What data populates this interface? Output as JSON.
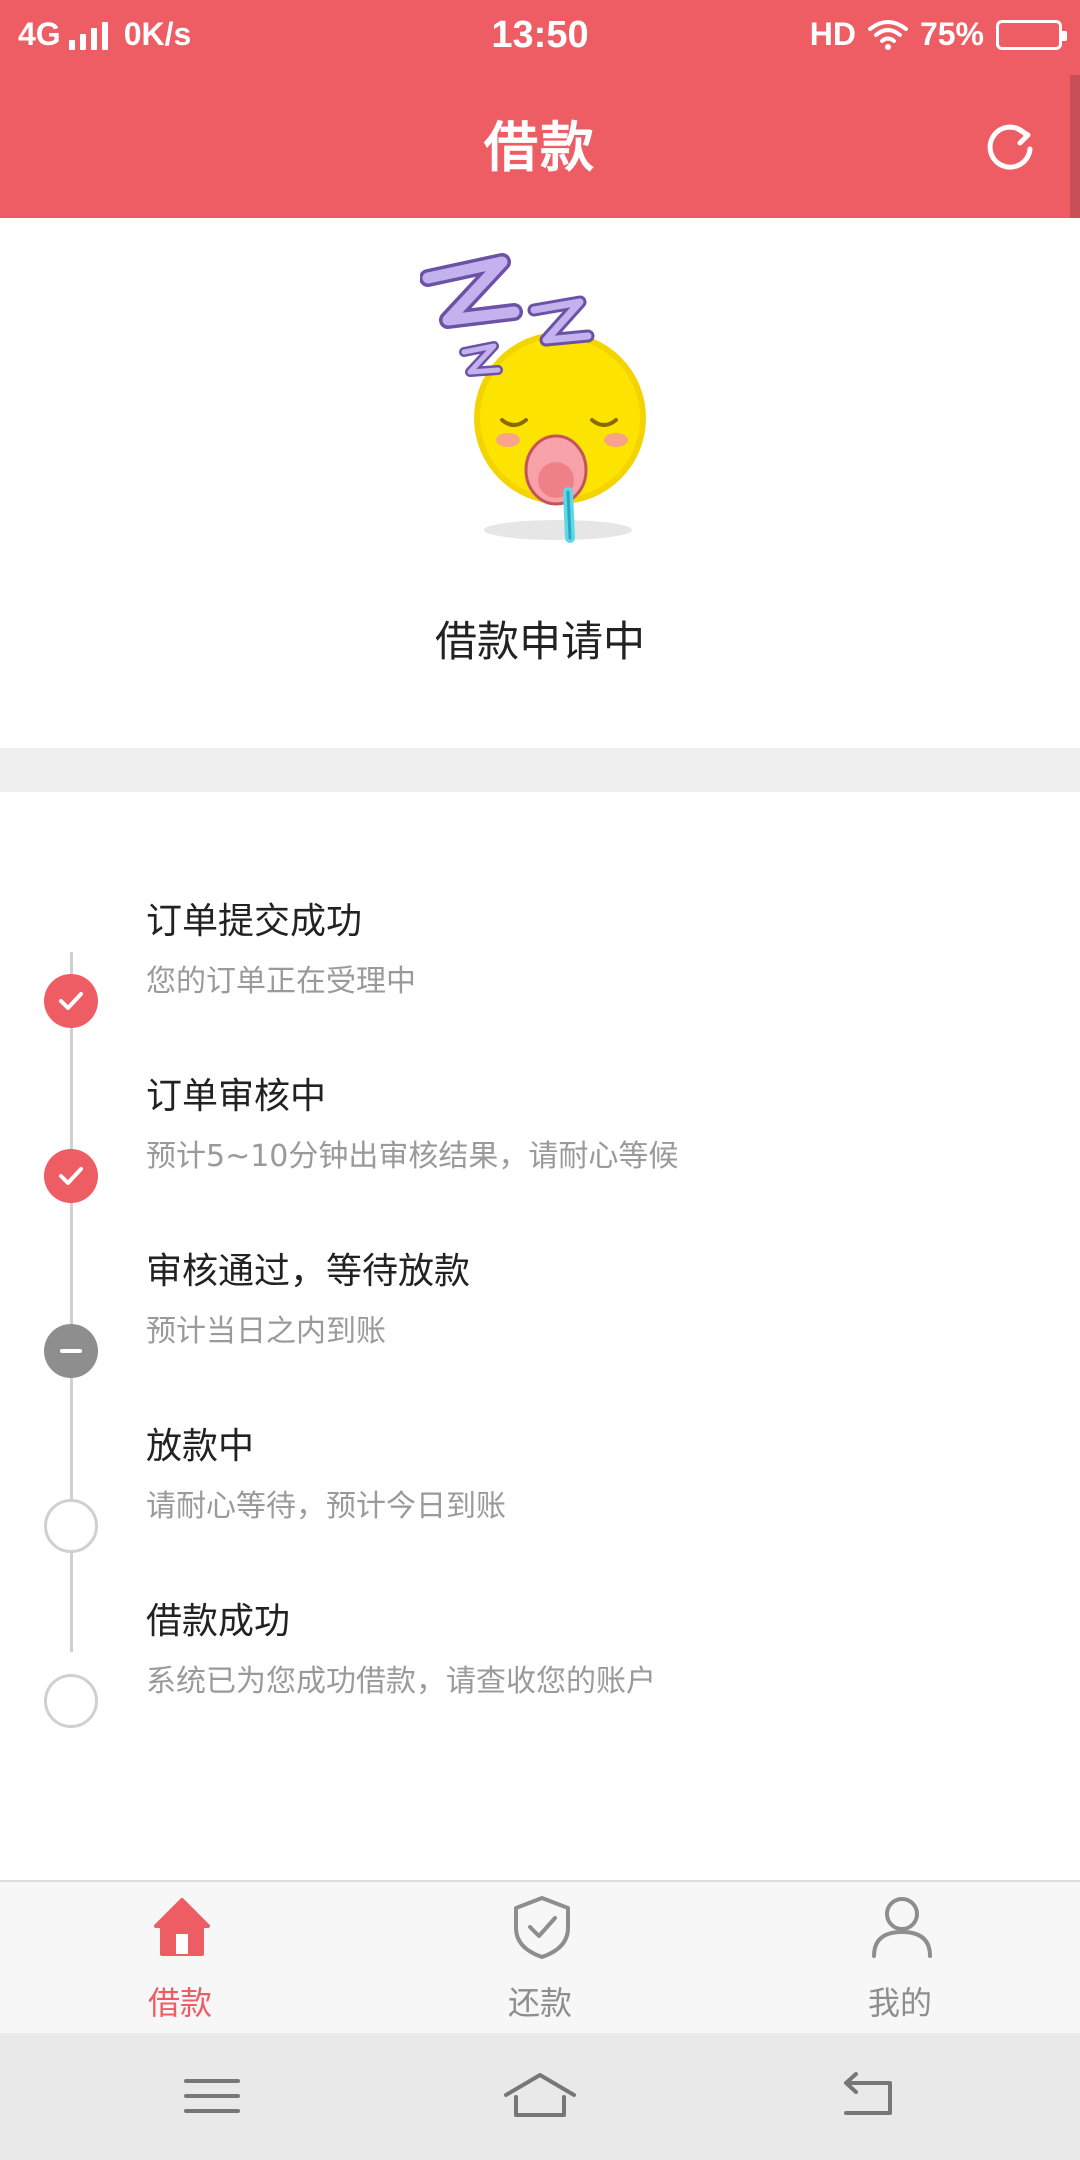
{
  "status_bar": {
    "network": "4G",
    "speed": "0K/s",
    "time": "13:50",
    "hd": "HD",
    "battery_pct": "75%",
    "battery_level": 0.75
  },
  "header": {
    "title": "借款",
    "refresh_icon": "refresh-icon"
  },
  "hero": {
    "illustration": "sleeping-emoji",
    "status": "借款申请中"
  },
  "steps": [
    {
      "title": "订单提交成功",
      "desc": "您的订单正在受理中",
      "state": "done"
    },
    {
      "title": "订单审核中",
      "desc": "预计5~10分钟出审核结果，请耐心等候",
      "state": "done"
    },
    {
      "title": "审核通过，等待放款",
      "desc": "预计当日之内到账",
      "state": "current"
    },
    {
      "title": "放款中",
      "desc": "请耐心等待，预计今日到账",
      "state": "pending"
    },
    {
      "title": "借款成功",
      "desc": "系统已为您成功借款，请查收您的账户",
      "state": "pending"
    }
  ],
  "bottom_nav": {
    "items": [
      {
        "label": "借款",
        "icon": "home-icon",
        "active": true
      },
      {
        "label": "还款",
        "icon": "shield-check-icon",
        "active": false
      },
      {
        "label": "我的",
        "icon": "user-icon",
        "active": false
      }
    ]
  },
  "system_nav": {
    "menu": "menu-icon",
    "home": "home-outline-icon",
    "back": "back-icon"
  },
  "colors": {
    "accent": "#ef5d64",
    "inactive_gray": "#8e8e8e",
    "text_dark": "#222222",
    "text_muted": "#9a9a9a"
  }
}
